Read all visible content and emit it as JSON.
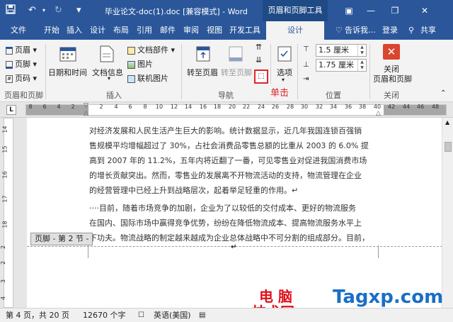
{
  "title_bar": {
    "title": "毕业论文-doc(1).doc [兼容模式] - Word",
    "context_group": "页眉和页脚工具"
  },
  "tabs": [
    "文件",
    "开始",
    "插入",
    "设计",
    "布局",
    "引用",
    "邮件",
    "审阅",
    "视图",
    "开发工具",
    "设计"
  ],
  "tell_me": "告诉我...",
  "login": "登录",
  "share": "共享",
  "ribbon": {
    "header_btn": "页眉",
    "footer_btn": "页脚",
    "pagenum_btn": "页码",
    "datetime": "日期和时间",
    "docinfo": "文档信息",
    "docparts": "文档部件",
    "picture": "图片",
    "online_picture": "联机图片",
    "goto_header": "转至页眉",
    "goto_footer": "转至页脚",
    "options": "选项",
    "header_pos": "1.5 厘米",
    "footer_pos": "1.75 厘米",
    "close_line1": "关闭",
    "close_line2": "页眉和页脚",
    "click_note": "单击",
    "groups": [
      "页眉和页脚",
      "插入",
      "导航",
      "位置",
      "关闭"
    ]
  },
  "ruler_ticks": [
    "8",
    "6",
    "4",
    "2",
    "2",
    "4",
    "6",
    "8",
    "10",
    "12",
    "14",
    "16",
    "18",
    "20",
    "22",
    "24",
    "26",
    "28",
    "30",
    "32",
    "34",
    "36",
    "38",
    "40",
    "42",
    "44",
    "46",
    "48"
  ],
  "vruler_ticks": [
    "14",
    "15",
    "16",
    "17",
    "18",
    "2",
    "2",
    "3",
    "4"
  ],
  "body": {
    "para1": [
      "对经济发展和人民生活产生巨大的影响。统计数据显示，近几年我国连锁百强销",
      "售规模平均增幅超过了 30%，占社会消费品零售总额的比重从 2003 的 6.0% 提",
      "高到 2007 年的 11.2%，五年内将近翻了一番，可见零售业对促进我国消费市场",
      "的增长贡献突出。然而，零售业的发展离不开物流活动的支持，物流管理在企业",
      "的经营管理中已经上升到战略层次，起着举足轻重的作用。↵"
    ],
    "para2": [
      "····目前，随着市场竞争的加剧，企业为了以较低的交付成本、更好的物流服务",
      "在国内、国际市场中赢得竞争优势，纷纷在降低物流成本、提高物流服务水平上",
      "下功夫。物流战略的制定越来越成为企业总体战略中不可分割的组成部分。目前，"
    ],
    "footer_label": "页脚 - 第 2 节 -",
    "footer_mark": "↵"
  },
  "status": {
    "page": "第 4 页，共 20 页",
    "words": "12670 个字",
    "lang": "英语(美国)"
  },
  "watermark": {
    "line1": "电 脑",
    "line2": "技术网",
    "site": "Tagxp.com"
  },
  "colors": {
    "accent": "#2b579a",
    "close_red": "#d9452f",
    "watermark_red": "#e0101a",
    "watermark_blue": "#1a6fc7"
  }
}
